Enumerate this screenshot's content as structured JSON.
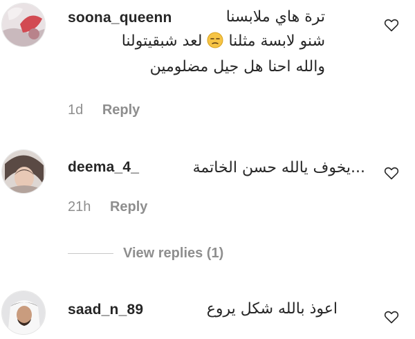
{
  "comments": [
    {
      "username": "soona_queenn",
      "lines": [
        "ترة هاي ملابسنا",
        "لعد شبقيتولنا",
        "والله احنا هل جيل مضلومين"
      ],
      "line2_prefix": "شنو لابسة مثلنا",
      "emoji_icon": "unamused-face-emoji",
      "time": "1d",
      "reply_label": "Reply"
    },
    {
      "username": "deema_4_",
      "text": "...يخوف يالله حسن الخاتمة",
      "time": "21h",
      "reply_label": "Reply",
      "view_replies": "View replies (1)"
    },
    {
      "username": "saad_n_89",
      "text": "اعوذ بالله شكل يروع"
    }
  ],
  "icons": {
    "like": "heart-outline-icon"
  },
  "colors": {
    "text": "#262626",
    "muted": "#8e8e8e",
    "divider": "#c7c7c7"
  }
}
